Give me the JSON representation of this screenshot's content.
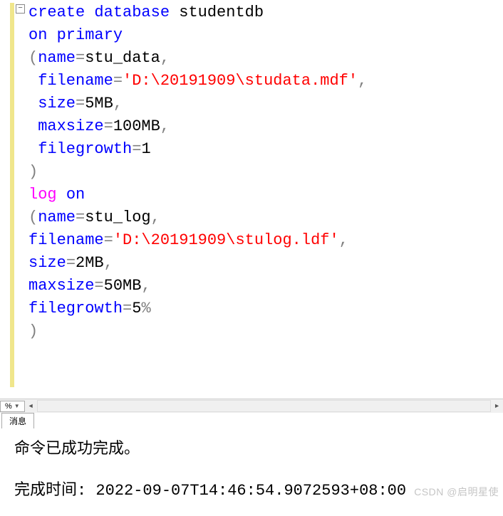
{
  "editor": {
    "fold_symbol": "−",
    "lines": [
      {
        "indent": "",
        "tokens": [
          {
            "t": "create database",
            "c": "kw-blue"
          },
          {
            "t": " studentdb",
            "c": "txt-black"
          }
        ]
      },
      {
        "indent": "",
        "tokens": [
          {
            "t": "on primary",
            "c": "kw-blue"
          }
        ]
      },
      {
        "indent": "",
        "tokens": [
          {
            "t": "(",
            "c": "kw-gray"
          },
          {
            "t": "name",
            "c": "kw-blue"
          },
          {
            "t": "=",
            "c": "kw-gray"
          },
          {
            "t": "stu_data",
            "c": "txt-black"
          },
          {
            "t": ",",
            "c": "kw-gray"
          }
        ]
      },
      {
        "indent": " ",
        "tokens": [
          {
            "t": "filename",
            "c": "kw-blue"
          },
          {
            "t": "=",
            "c": "kw-gray"
          },
          {
            "t": "'D:\\20191909\\studata.mdf'",
            "c": "kw-red"
          },
          {
            "t": ",",
            "c": "kw-gray"
          }
        ]
      },
      {
        "indent": " ",
        "tokens": [
          {
            "t": "size",
            "c": "kw-blue"
          },
          {
            "t": "=",
            "c": "kw-gray"
          },
          {
            "t": "5MB",
            "c": "txt-black"
          },
          {
            "t": ",",
            "c": "kw-gray"
          }
        ]
      },
      {
        "indent": " ",
        "tokens": [
          {
            "t": "maxsize",
            "c": "kw-blue"
          },
          {
            "t": "=",
            "c": "kw-gray"
          },
          {
            "t": "100MB",
            "c": "txt-black"
          },
          {
            "t": ",",
            "c": "kw-gray"
          }
        ]
      },
      {
        "indent": " ",
        "tokens": [
          {
            "t": "filegrowth",
            "c": "kw-blue"
          },
          {
            "t": "=",
            "c": "kw-gray"
          },
          {
            "t": "1",
            "c": "txt-black"
          }
        ]
      },
      {
        "indent": "",
        "tokens": [
          {
            "t": ")",
            "c": "kw-gray"
          }
        ]
      },
      {
        "indent": "",
        "tokens": [
          {
            "t": "log",
            "c": "kw-magenta"
          },
          {
            "t": " ",
            "c": "txt-black"
          },
          {
            "t": "on",
            "c": "kw-blue"
          }
        ]
      },
      {
        "indent": "",
        "tokens": [
          {
            "t": "(",
            "c": "kw-gray"
          },
          {
            "t": "name",
            "c": "kw-blue"
          },
          {
            "t": "=",
            "c": "kw-gray"
          },
          {
            "t": "stu_log",
            "c": "txt-black"
          },
          {
            "t": ",",
            "c": "kw-gray"
          }
        ]
      },
      {
        "indent": "",
        "tokens": [
          {
            "t": "filename",
            "c": "kw-blue"
          },
          {
            "t": "=",
            "c": "kw-gray"
          },
          {
            "t": "'D:\\20191909\\stulog.ldf'",
            "c": "kw-red"
          },
          {
            "t": ",",
            "c": "kw-gray"
          }
        ]
      },
      {
        "indent": "",
        "tokens": [
          {
            "t": "size",
            "c": "kw-blue"
          },
          {
            "t": "=",
            "c": "kw-gray"
          },
          {
            "t": "2MB",
            "c": "txt-black"
          },
          {
            "t": ",",
            "c": "kw-gray"
          }
        ]
      },
      {
        "indent": "",
        "tokens": [
          {
            "t": "maxsize",
            "c": "kw-blue"
          },
          {
            "t": "=",
            "c": "kw-gray"
          },
          {
            "t": "50MB",
            "c": "txt-black"
          },
          {
            "t": ",",
            "c": "kw-gray"
          }
        ]
      },
      {
        "indent": "",
        "tokens": [
          {
            "t": "filegrowth",
            "c": "kw-blue"
          },
          {
            "t": "=",
            "c": "kw-gray"
          },
          {
            "t": "5",
            "c": "txt-black"
          },
          {
            "t": "%",
            "c": "kw-gray"
          }
        ]
      },
      {
        "indent": "",
        "tokens": [
          {
            "t": ")",
            "c": "kw-gray"
          }
        ]
      }
    ]
  },
  "zoom": {
    "value": "%"
  },
  "tab": {
    "label": "消息"
  },
  "messages": {
    "line1": "命令已成功完成。",
    "line2": "完成时间: 2022-09-07T14:46:54.9072593+08:00"
  },
  "watermark": "CSDN @启明星使"
}
